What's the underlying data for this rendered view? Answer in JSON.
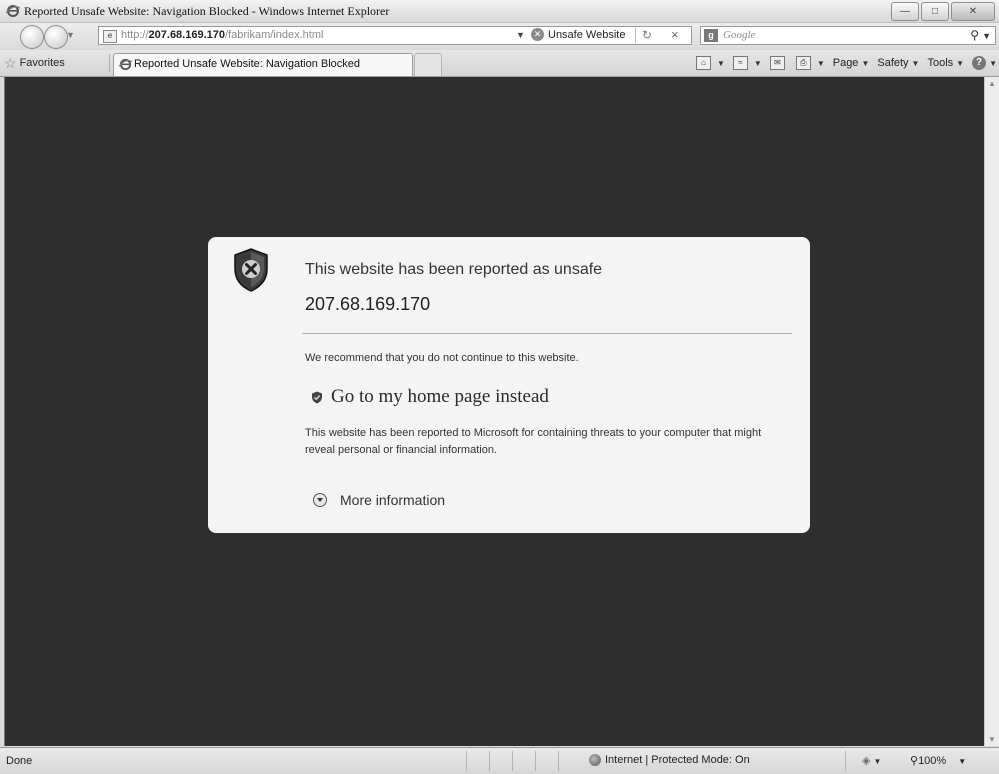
{
  "window": {
    "title": "Reported Unsafe Website: Navigation Blocked - Windows Internet Explorer"
  },
  "address": {
    "url_prefix": "http://",
    "url_host": "207.68.169.170",
    "url_path": "/fabrikam/index.html",
    "unsafe_label": "Unsafe Website"
  },
  "search": {
    "placeholder": "Google"
  },
  "tabs": {
    "favorites_label": "Favorites",
    "active_tab_label": "Reported Unsafe Website: Navigation Blocked"
  },
  "commands": {
    "page": "Page",
    "safety": "Safety",
    "tools": "Tools"
  },
  "warning": {
    "title": "This website has been reported as unsafe",
    "ip": "207.68.169.170",
    "recommendation": "We recommend that you do not continue to this website.",
    "home_link": "Go to my home page instead",
    "explanation": "This website has been reported to Microsoft for containing threats to your computer that might reveal personal or financial information.",
    "more_info": "More information"
  },
  "status": {
    "text": "Done",
    "zone": "Internet | Protected Mode: On",
    "zoom": "100%"
  }
}
